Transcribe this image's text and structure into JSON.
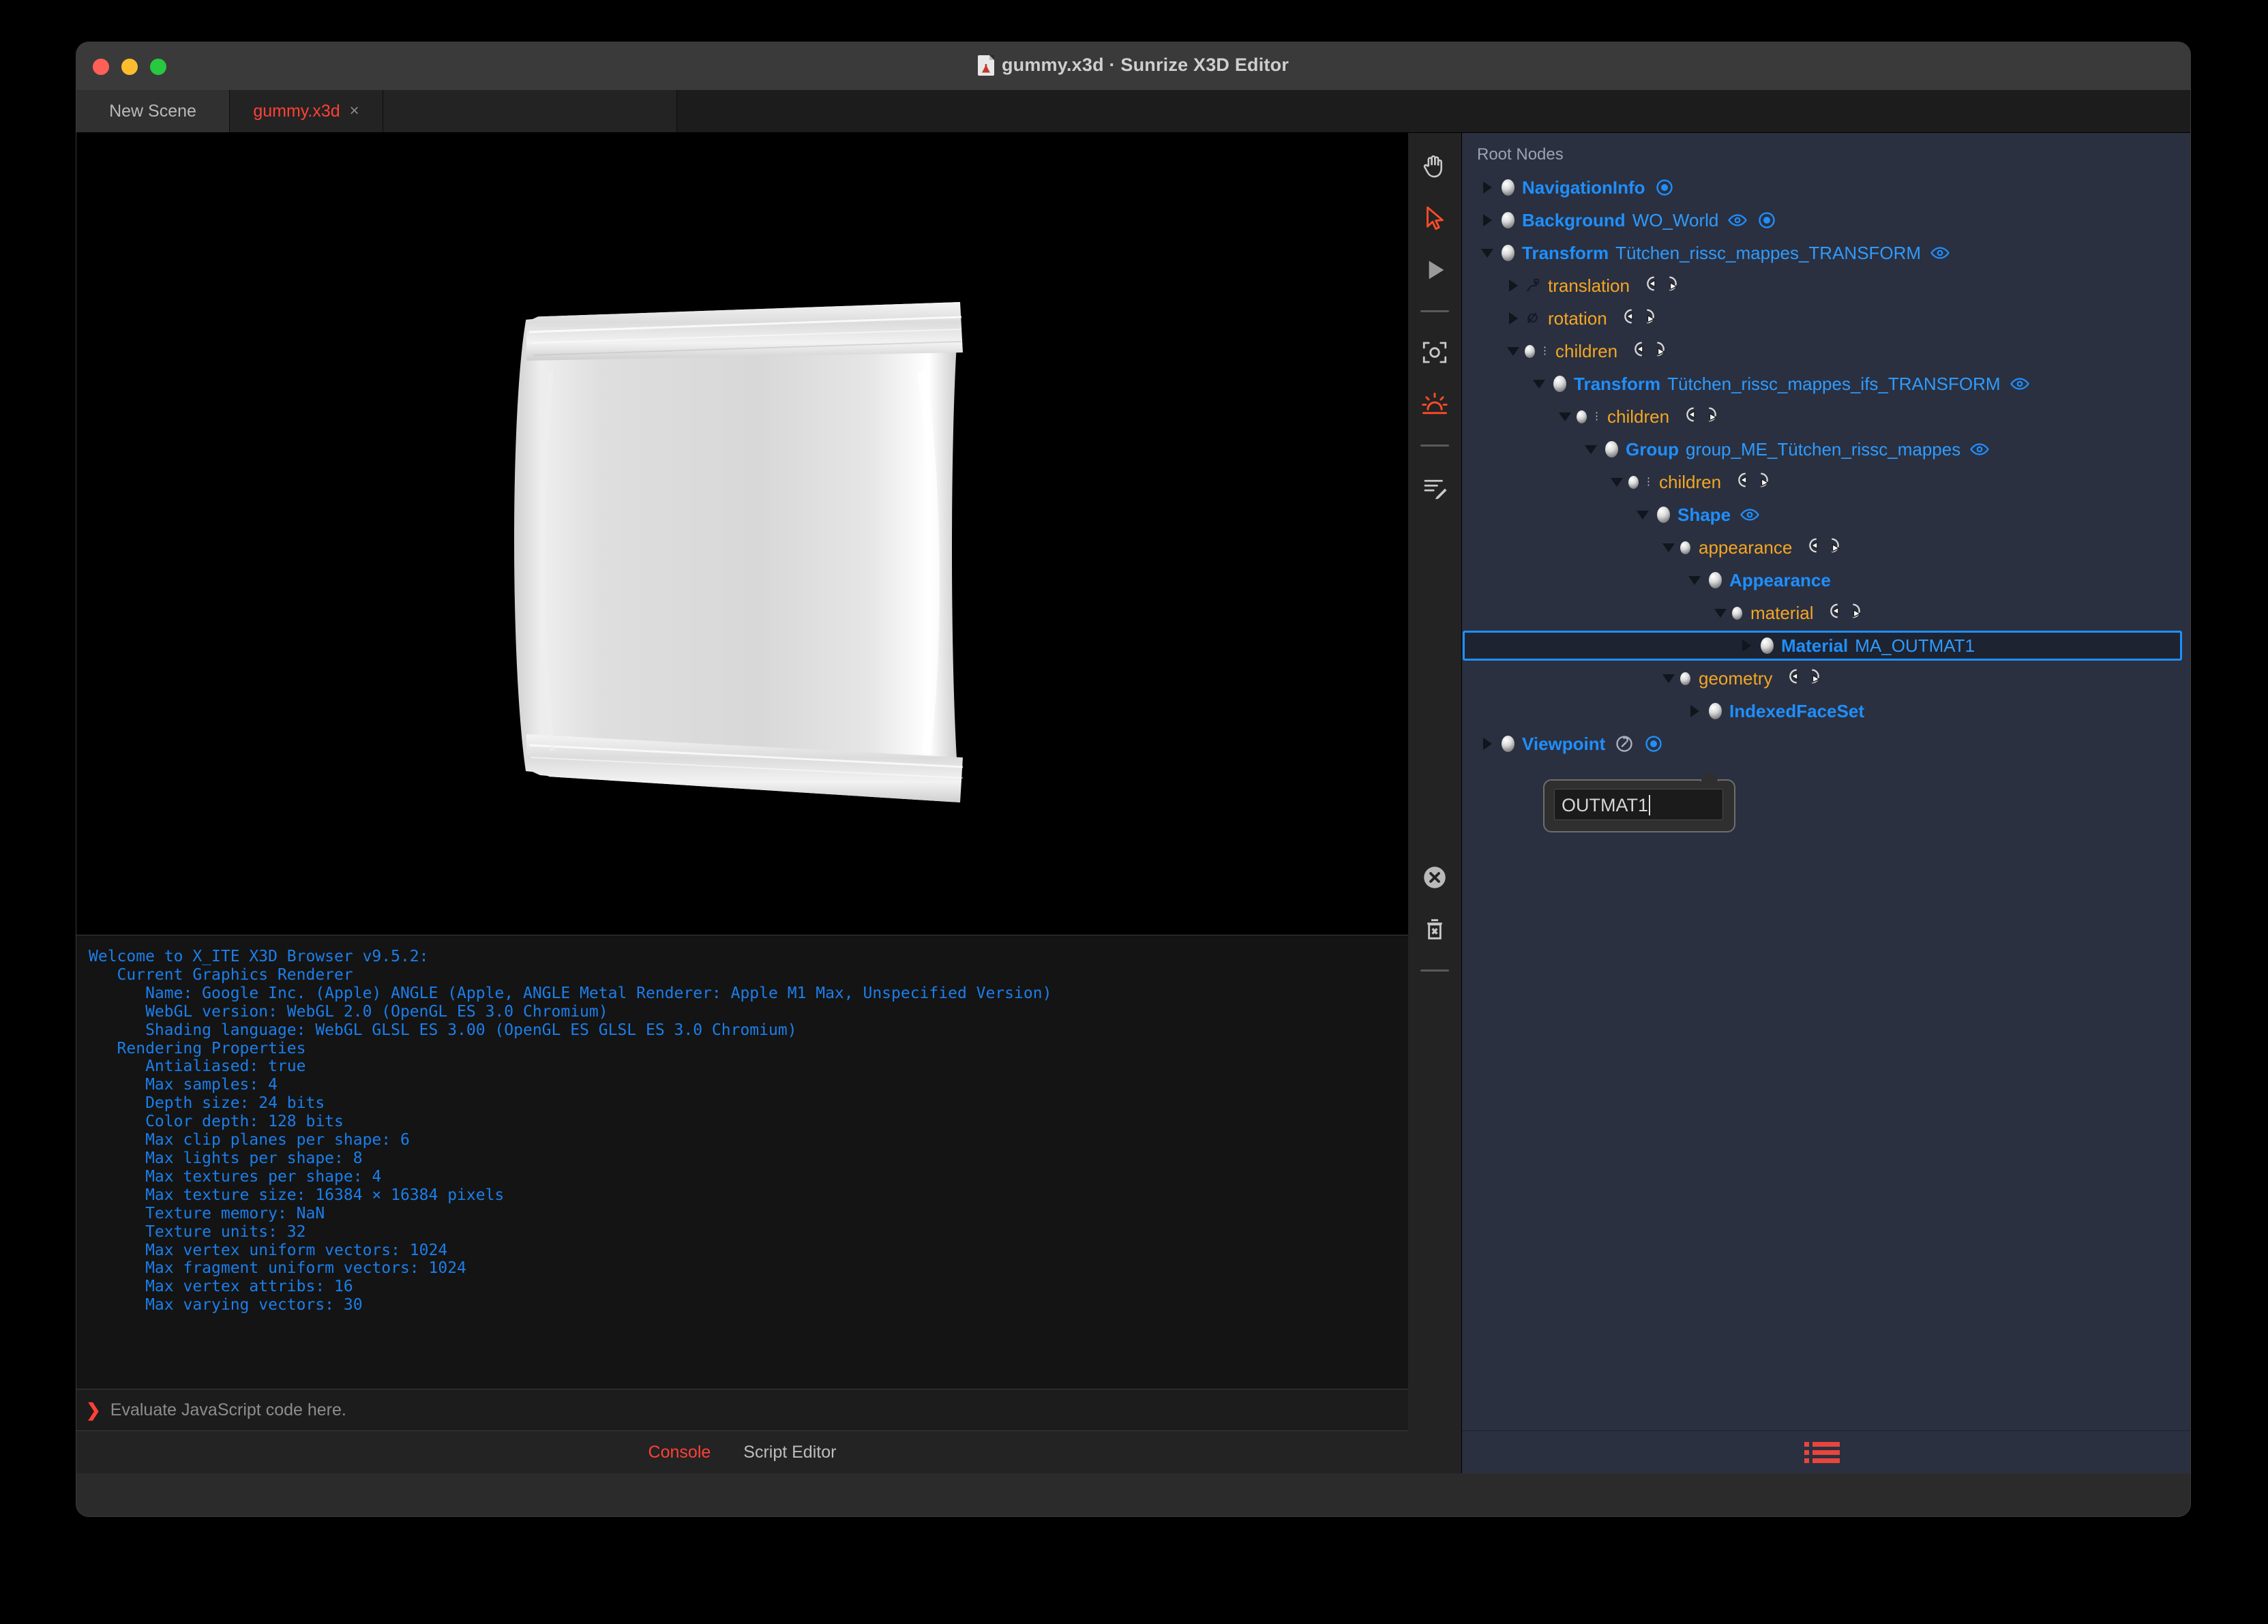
{
  "window": {
    "title": "gummy.x3d · Sunrize X3D Editor",
    "doc_icon": "x3d-document-icon",
    "traffic": [
      "close-button",
      "minimize-button",
      "maximize-button"
    ]
  },
  "tabs": [
    {
      "label": "New Scene",
      "active": false,
      "closable": false
    },
    {
      "label": "gummy.x3d",
      "active": true,
      "closable": true,
      "close_label": "×"
    }
  ],
  "toolrail": {
    "items": [
      {
        "name": "hand-tool-icon",
        "active": false
      },
      {
        "name": "select-arrow-icon",
        "active": true
      },
      {
        "name": "play-icon",
        "active": false
      },
      {
        "name": "separator",
        "active": false
      },
      {
        "name": "viewpoint-frame-icon",
        "active": false
      },
      {
        "name": "sunrise-light-icon",
        "active": true
      },
      {
        "name": "separator",
        "active": false
      },
      {
        "name": "edit-lines-icon",
        "active": false
      }
    ],
    "bottom_items": [
      {
        "name": "clear-console-icon"
      },
      {
        "name": "trash-icon"
      },
      {
        "name": "separator"
      }
    ]
  },
  "viewport": {
    "object": "gummy-wrapper-model",
    "background": "#000000"
  },
  "console": {
    "text": "Welcome to X_ITE X3D Browser v9.5.2:\n   Current Graphics Renderer\n      Name: Google Inc. (Apple) ANGLE (Apple, ANGLE Metal Renderer: Apple M1 Max, Unspecified Version)\n      WebGL version: WebGL 2.0 (OpenGL ES 3.0 Chromium)\n      Shading language: WebGL GLSL ES 3.00 (OpenGL ES GLSL ES 3.0 Chromium)\n   Rendering Properties\n      Antialiased: true\n      Max samples: 4\n      Depth size: 24 bits\n      Color depth: 128 bits\n      Max clip planes per shape: 6\n      Max lights per shape: 8\n      Max textures per shape: 4\n      Max texture size: 16384 × 16384 pixels\n      Texture memory: NaN\n      Texture units: 32\n      Max vertex uniform vectors: 1024\n      Max fragment uniform vectors: 1024\n      Max vertex attribs: 16\n      Max varying vectors: 30",
    "prompt_chevron": "❯",
    "input_placeholder": "Evaluate JavaScript code here."
  },
  "bottom_tabs": [
    {
      "label": "Console",
      "active": true
    },
    {
      "label": "Script Editor",
      "active": false
    }
  ],
  "tree": {
    "header": "Root Nodes",
    "bottom_icon": "node-list-icon",
    "rows": [
      {
        "indent": 0,
        "twisty": "closed",
        "ball": "node",
        "type": "NavigationInfo",
        "name": "",
        "icons": [
          "radio"
        ],
        "kind": "node",
        "selected": false
      },
      {
        "indent": 0,
        "twisty": "closed",
        "ball": "node",
        "type": "Background",
        "name": "WO_World",
        "icons": [
          "eye",
          "radio"
        ],
        "kind": "node",
        "selected": false
      },
      {
        "indent": 0,
        "twisty": "open",
        "ball": "node",
        "type": "Transform",
        "name": "Tütchen_rissc_mappes_TRANSFORM",
        "icons": [
          "eye"
        ],
        "kind": "node",
        "selected": false
      },
      {
        "indent": 1,
        "twisty": "closed",
        "ball": "translation-field-icon",
        "type": "",
        "name": "translation",
        "icons": [
          "routes"
        ],
        "kind": "field",
        "selected": false
      },
      {
        "indent": 1,
        "twisty": "closed",
        "ball": "rotation-field-icon",
        "type": "",
        "name": "rotation",
        "icons": [
          "routes"
        ],
        "kind": "field",
        "selected": false
      },
      {
        "indent": 1,
        "twisty": "open",
        "ball": "mfnode-field-icon",
        "type": "",
        "name": "children",
        "icons": [
          "routes"
        ],
        "kind": "field",
        "selected": false
      },
      {
        "indent": 2,
        "twisty": "open",
        "ball": "node",
        "type": "Transform",
        "name": "Tütchen_rissc_mappes_ifs_TRANSFORM",
        "icons": [
          "eye"
        ],
        "kind": "node",
        "selected": false
      },
      {
        "indent": 3,
        "twisty": "open",
        "ball": "mfnode-field-icon",
        "type": "",
        "name": "children",
        "icons": [
          "routes"
        ],
        "kind": "field",
        "selected": false
      },
      {
        "indent": 4,
        "twisty": "open",
        "ball": "node",
        "type": "Group",
        "name": "group_ME_Tütchen_rissc_mappes",
        "icons": [
          "eye"
        ],
        "kind": "node",
        "selected": false
      },
      {
        "indent": 5,
        "twisty": "open",
        "ball": "mfnode-field-icon",
        "type": "",
        "name": "children",
        "icons": [
          "routes"
        ],
        "kind": "field",
        "selected": false
      },
      {
        "indent": 6,
        "twisty": "open",
        "ball": "node",
        "type": "Shape",
        "name": "",
        "icons": [
          "eye"
        ],
        "kind": "node",
        "selected": false
      },
      {
        "indent": 7,
        "twisty": "open",
        "ball": "sfnode-field-icon",
        "type": "",
        "name": "appearance",
        "icons": [
          "routes"
        ],
        "kind": "field",
        "selected": false
      },
      {
        "indent": 8,
        "twisty": "open",
        "ball": "node",
        "type": "Appearance",
        "name": "",
        "icons": [],
        "kind": "node",
        "selected": false
      },
      {
        "indent": 9,
        "twisty": "open",
        "ball": "sfnode-field-icon",
        "type": "",
        "name": "material",
        "icons": [
          "routes"
        ],
        "kind": "field",
        "selected": false
      },
      {
        "indent": 10,
        "twisty": "closed",
        "ball": "node",
        "type": "Material",
        "name": "MA_OUTMAT1",
        "icons": [],
        "kind": "node",
        "selected": true
      },
      {
        "indent": 7,
        "twisty": "open",
        "ball": "sfnode-field-icon",
        "type": "",
        "name": "geometry",
        "icons": [
          "routes"
        ],
        "kind": "field",
        "selected": false
      },
      {
        "indent": 8,
        "twisty": "closed",
        "ball": "node",
        "type": "IndexedFaceSet",
        "name": "",
        "icons": [],
        "kind": "node",
        "selected": false
      },
      {
        "indent": 0,
        "twisty": "closed",
        "ball": "node",
        "type": "Viewpoint",
        "name": "",
        "icons": [
          "wrench",
          "radio"
        ],
        "kind": "node",
        "selected": false
      }
    ]
  },
  "rename_popover": {
    "value": "OUTMAT1",
    "has_caret": true
  },
  "colors": {
    "panel_bg": "#2a3040",
    "node_blue": "#1f8fff",
    "field_orange": "#f5a623",
    "accent_red": "#ff4136",
    "console_blue": "#1b7eeb",
    "selection_border": "#1f8fff"
  }
}
